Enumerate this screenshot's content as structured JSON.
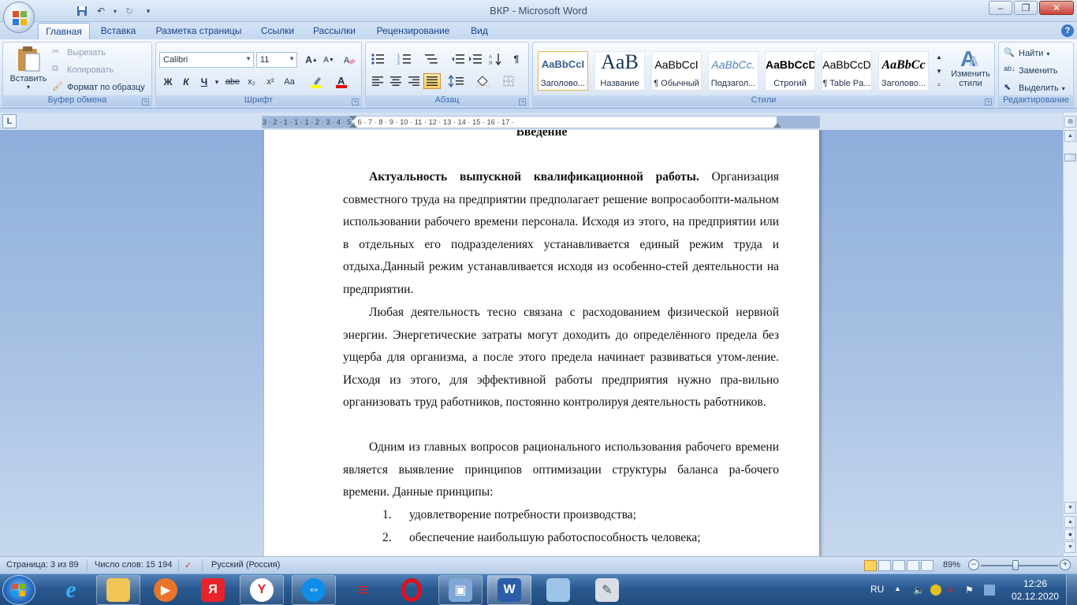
{
  "window": {
    "title": "ВКР - Microsoft Word"
  },
  "tabs": [
    {
      "label": "Главная",
      "active": true
    },
    {
      "label": "Вставка"
    },
    {
      "label": "Разметка страницы"
    },
    {
      "label": "Ссылки"
    },
    {
      "label": "Рассылки"
    },
    {
      "label": "Рецензирование"
    },
    {
      "label": "Вид"
    }
  ],
  "ribbon": {
    "clipboard": {
      "label": "Буфер обмена",
      "paste": "Вставить",
      "cut": "Вырезать",
      "copy": "Копировать",
      "format_painter": "Формат по образцу"
    },
    "font": {
      "label": "Шрифт",
      "font_name": "Calibri",
      "font_size": "11",
      "bold": "Ж",
      "italic": "К",
      "underline": "Ч",
      "strike": "abe",
      "subscript": "x₂",
      "superscript": "x²",
      "change_case": "Aa"
    },
    "paragraph": {
      "label": "Абзац"
    },
    "styles": {
      "label": "Стили",
      "change_styles": "Изменить стили",
      "tiles": [
        {
          "sample": "AaBbCcI",
          "name": "Заголово..."
        },
        {
          "sample": "AaB",
          "name": "Название"
        },
        {
          "sample": "AaBbCcI",
          "name": "¶ Обычный"
        },
        {
          "sample": "AaBbCc.",
          "name": "Подзагол..."
        },
        {
          "sample": "AaBbCcD",
          "name": "Строгий"
        },
        {
          "sample": "AaBbCcD",
          "name": "¶ Table Pa..."
        },
        {
          "sample": "AaBbCc",
          "name": "Заголово..."
        }
      ]
    },
    "editing": {
      "label": "Редактирование",
      "find": "Найти",
      "replace": "Заменить",
      "select": "Выделить"
    }
  },
  "ruler": {
    "labels": "3 · 2 · 1 · 1 · 1 · 2 · 3 · 4 · 5 · 6 · 7 · 8 · 9 · 10 · 11 · 12 · 13 · 14 · 15 · 16 · 17 ·"
  },
  "document": {
    "heading": "Введение",
    "p1_bold": "Актуальность выпускной квалификационной работы.",
    "p1_rest": " Организация совместного труда на предприятии предполагает решение вопросаобопти-мальном использовании рабочего времени персонала. Исходя из этого, на предприятии или в отдельных его подразделениях устанавливается единый режим труда и отдыха.Данный режим устанавливается исходя из особенно-стей деятельности на предприятии.",
    "p2": "Любая деятельность тесно связана с расходованием физической нервной энергии. Энергетические затраты могут доходить до определённого предела без ущерба для организма, а после этого предела начинает развиваться утом-ление. Исходя из этого, для эффективной работы предприятия нужно пра-вильно организовать труд работников, постоянно контролируя деятельность работников.",
    "p3": "Одним из главных вопросов рационального использования рабочего времени является выявление принципов оптимизации структуры баланса ра-бочего времени. Данные принципы:",
    "list": [
      {
        "num": "1.",
        "text": "удовлетворение потребности производства;"
      },
      {
        "num": "2.",
        "text": "обеспечение наибольшую работоспособность человека;"
      }
    ]
  },
  "statusbar": {
    "page": "Страница: 3 из 89",
    "words": "Число слов: 15 194",
    "language": "Русский (Россия)",
    "zoom": "89%"
  },
  "taskbar": {
    "lang": "RU",
    "time": "12:26",
    "date": "02.12.2020"
  },
  "colors": {
    "ribbon_text": "#15428b",
    "taskbar": "#2a5a91",
    "doc_background": "#a9c2e4"
  }
}
